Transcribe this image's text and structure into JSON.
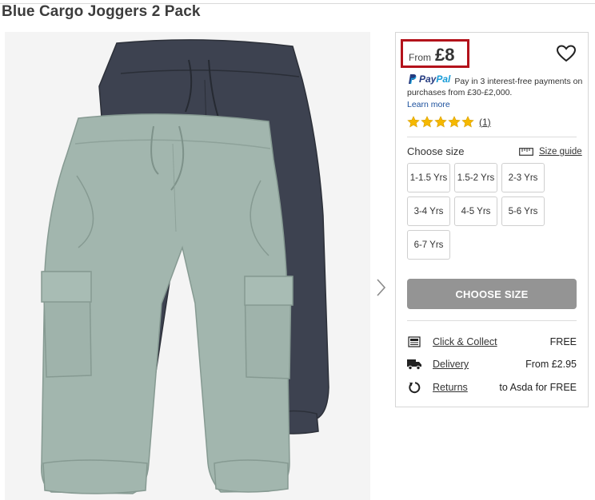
{
  "product": {
    "title": "Blue Cargo Joggers 2 Pack"
  },
  "price": {
    "prefix": "From",
    "amount": "£8"
  },
  "paypal": {
    "brand_pay": "Pay",
    "brand_pal": "Pal",
    "message": "Pay in 3 interest-free payments on purchases from £30-£2,000.",
    "learn_more": "Learn more"
  },
  "rating": {
    "stars": 5,
    "review_count": "(1)",
    "star_color": "#f5b800"
  },
  "size_selector": {
    "label": "Choose size",
    "guide_label": "Size guide",
    "options": [
      "1-1.5 Yrs",
      "1.5-2 Yrs",
      "2-3 Yrs",
      "3-4 Yrs",
      "4-5 Yrs",
      "5-6 Yrs",
      "6-7 Yrs"
    ]
  },
  "cta": {
    "label": "CHOOSE SIZE",
    "color": "#949494"
  },
  "delivery_options": [
    {
      "icon": "store-icon",
      "label": "Click & Collect",
      "value": "FREE"
    },
    {
      "icon": "truck-icon",
      "label": "Delivery",
      "value": "From £2.95"
    },
    {
      "icon": "return-icon",
      "label": "Returns",
      "value": "to Asda for FREE"
    }
  ],
  "colors": {
    "price_highlight": "#b3121b",
    "link": "#1a4f9c",
    "pants_front": "#9fb3ab",
    "pants_back": "#3c4250"
  }
}
